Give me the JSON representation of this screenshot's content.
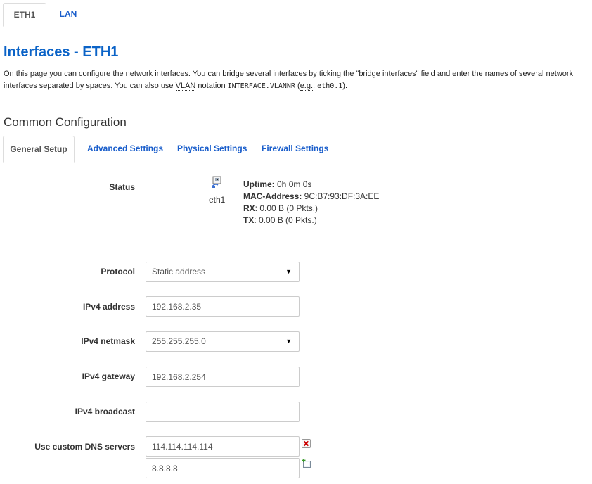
{
  "top_tabs": [
    {
      "label": "ETH1",
      "active": true
    },
    {
      "label": "LAN",
      "active": false
    }
  ],
  "page": {
    "title": "Interfaces - ETH1",
    "desc_part1": "On this page you can configure the network interfaces. You can bridge several interfaces by ticking the \"bridge interfaces\" field and enter the names of several network interfaces separated by spaces. You can also use ",
    "desc_abbr_vlan": "VLAN",
    "desc_part2": " notation ",
    "desc_mono1": "INTERFACE.VLANNR",
    "desc_part3": " (",
    "desc_abbr_eg": "e.g.",
    "desc_part4": ": ",
    "desc_mono2": "eth0.1",
    "desc_part5": ")."
  },
  "section": {
    "title": "Common Configuration"
  },
  "sub_tabs": [
    {
      "label": "General Setup",
      "active": true
    },
    {
      "label": "Advanced Settings",
      "active": false
    },
    {
      "label": "Physical Settings",
      "active": false
    },
    {
      "label": "Firewall Settings",
      "active": false
    }
  ],
  "status": {
    "label": "Status",
    "icon": "network-port-icon",
    "iface": "eth1",
    "uptime_label": "Uptime:",
    "uptime_value": " 0h 0m 0s",
    "mac_label": "MAC-Address:",
    "mac_value": " 9C:B7:93:DF:3A:EE",
    "rx_label": "RX",
    "rx_value": ": 0.00 B (0 Pkts.)",
    "tx_label": "TX",
    "tx_value": ": 0.00 B (0 Pkts.)"
  },
  "form": {
    "protocol": {
      "label": "Protocol",
      "value": "Static address"
    },
    "ipv4_address": {
      "label": "IPv4 address",
      "value": "192.168.2.35"
    },
    "ipv4_netmask": {
      "label": "IPv4 netmask",
      "value": "255.255.255.0"
    },
    "ipv4_gateway": {
      "label": "IPv4 gateway",
      "value": "192.168.2.254"
    },
    "ipv4_broadcast": {
      "label": "IPv4 broadcast",
      "value": ""
    },
    "dns": {
      "label": "Use custom DNS servers",
      "values": [
        "114.114.114.114",
        "8.8.8.8"
      ]
    }
  },
  "colors": {
    "link": "#1a5ecb",
    "title": "#0b63c7",
    "remove": "#cc0000",
    "add": "#3a9a2a"
  }
}
